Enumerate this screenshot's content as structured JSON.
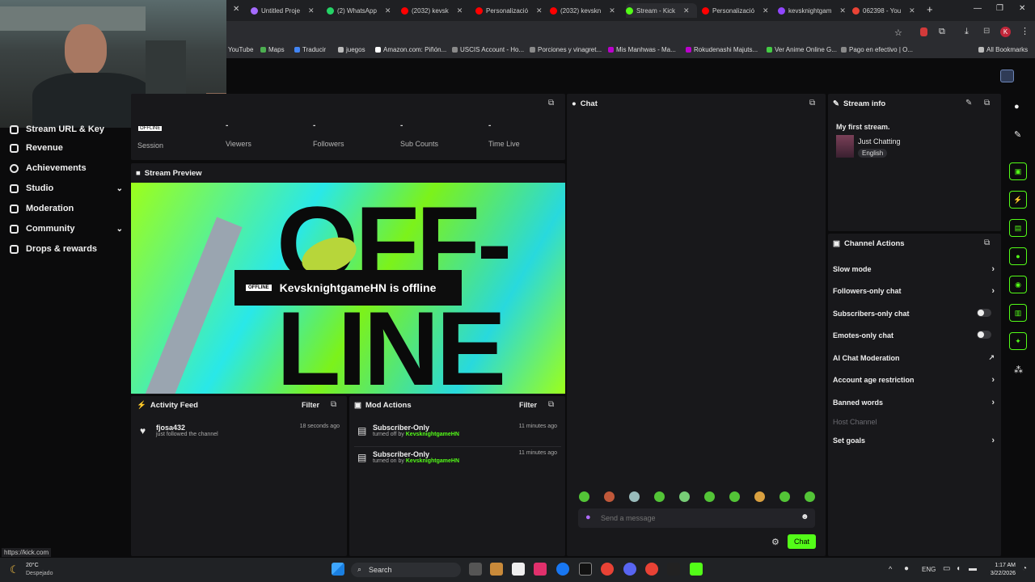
{
  "browser": {
    "tabs": [
      {
        "label": "Untitled Proje",
        "color": "#a56bff"
      },
      {
        "label": "(2) WhatsApp",
        "color": "#25d366"
      },
      {
        "label": "(2032) kevsk",
        "color": "#ff0000"
      },
      {
        "label": "Personalizació",
        "color": "#ff0000"
      },
      {
        "label": "(2032) kevskn",
        "color": "#ff0000"
      },
      {
        "label": "Stream - Kick",
        "color": "#53fc18"
      },
      {
        "label": "Personalizació",
        "color": "#ff0000"
      },
      {
        "label": "kevsknightgam",
        "color": "#9146ff"
      },
      {
        "label": "062398 - You",
        "color": "#ea4335"
      }
    ],
    "new_tab": "+",
    "bookmarks": [
      "YouTube",
      "Maps",
      "Traducir",
      "juegos",
      "Amazon.com: Piñón...",
      "USCIS Account - Ho...",
      "Porciones y vinagret...",
      "Mis Manhwas - Ma...",
      "Rokudenashi Majuts...",
      "Ver Anime Online G...",
      "Pago en efectivo | O..."
    ],
    "all_bookmarks": "All Bookmarks",
    "status_url": "https://kick.com"
  },
  "sidebar": {
    "items": [
      {
        "label": "Stream URL & Key"
      },
      {
        "label": "Revenue"
      },
      {
        "label": "Achievements"
      },
      {
        "label": "Studio",
        "chevron": "⌄"
      },
      {
        "label": "Moderation"
      },
      {
        "label": "Community",
        "chevron": "⌄"
      },
      {
        "label": "Drops & rewards"
      }
    ]
  },
  "stats": {
    "offline_badge": "OFFLINE",
    "session": "Session",
    "items": [
      {
        "value": "-",
        "label": "Viewers"
      },
      {
        "value": "-",
        "label": "Followers"
      },
      {
        "value": "-",
        "label": "Sub Counts"
      },
      {
        "value": "-",
        "label": "Time Live"
      }
    ]
  },
  "preview": {
    "title": "Stream Preview",
    "badge": "OFFLINE",
    "message": "KevsknightgameHN is offline",
    "bg_text_1": "OFF-",
    "bg_text_2": "LINE"
  },
  "activity": {
    "title": "Activity Feed",
    "filter": "Filter",
    "items": [
      {
        "name": "fjosa432",
        "sub": "just followed the channel",
        "time": "18 seconds ago"
      }
    ]
  },
  "mod_actions": {
    "title": "Mod Actions",
    "filter": "Filter",
    "items": [
      {
        "name": "Subscriber-Only",
        "prefix": "turned off by",
        "user": "KevsknightgameHN",
        "time": "11 minutes ago"
      },
      {
        "name": "Subscriber-Only",
        "prefix": "turned on by",
        "user": "KevsknightgameHN",
        "time": "11 minutes ago"
      }
    ]
  },
  "chat": {
    "title": "Chat",
    "placeholder": "Send a message",
    "send": "Chat"
  },
  "stream_info": {
    "title": "Stream info",
    "stream_title": "My first stream.",
    "category": "Just Chatting",
    "language": "English"
  },
  "channel_actions": {
    "title": "Channel Actions",
    "items": [
      {
        "label": "Slow mode",
        "control": "chevron"
      },
      {
        "label": "Followers-only chat",
        "control": "chevron"
      },
      {
        "label": "Subscribers-only chat",
        "control": "toggle"
      },
      {
        "label": "Emotes-only chat",
        "control": "toggle"
      },
      {
        "label": "AI Chat Moderation",
        "control": "external"
      },
      {
        "label": "Account age restriction",
        "control": "chevron"
      },
      {
        "label": "Banned words",
        "control": "chevron"
      },
      {
        "label": "Host Channel",
        "control": "none",
        "disabled": true
      },
      {
        "label": "Set goals",
        "control": "chevron"
      }
    ]
  },
  "taskbar": {
    "weather_temp": "20°C",
    "weather_desc": "Despejado",
    "search": "Search",
    "lang": "ENG",
    "time": "1:17 AM",
    "date": "3/22/2026"
  },
  "colors": {
    "accent": "#53fc18",
    "panel": "#18181b",
    "bg": "#0b0b0c"
  }
}
